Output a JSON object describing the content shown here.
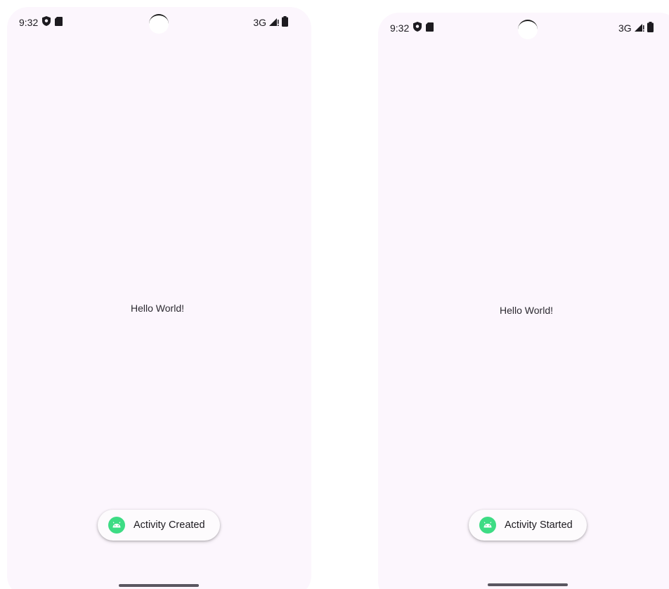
{
  "screens": [
    {
      "status": {
        "time": "9:32",
        "network": "3G"
      },
      "message": "Hello World!",
      "toast": {
        "label": "Activity Created"
      }
    },
    {
      "status": {
        "time": "9:32",
        "network": "3G"
      },
      "message": "Hello World!",
      "toast": {
        "label": "Activity Started"
      }
    }
  ],
  "icons": {
    "status_left": [
      "shield-icon",
      "sd-card-icon"
    ],
    "status_right": [
      "signal-icon",
      "battery-icon"
    ],
    "toast": "android-icon"
  },
  "colors": {
    "screen_background": "#fcf6fd",
    "android_badge": "#3ddc84",
    "text": "#1d1b20"
  }
}
